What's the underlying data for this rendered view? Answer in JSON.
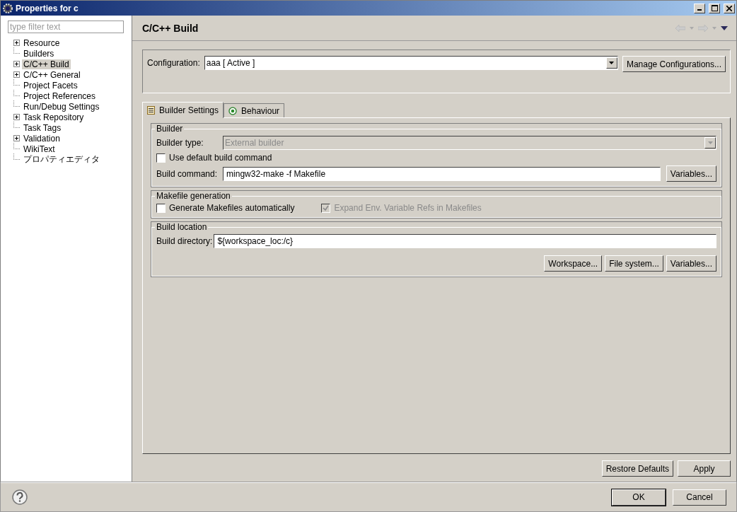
{
  "window": {
    "title": "Properties for c"
  },
  "sidebar": {
    "filter": {
      "placeholder": "type filter text"
    },
    "items": [
      {
        "label": "Resource",
        "kind": "expandable",
        "selected": false
      },
      {
        "label": "Builders",
        "kind": "leaf",
        "selected": false
      },
      {
        "label": "C/C++ Build",
        "kind": "expandable",
        "selected": true
      },
      {
        "label": "C/C++ General",
        "kind": "expandable",
        "selected": false
      },
      {
        "label": "Project Facets",
        "kind": "leaf",
        "selected": false
      },
      {
        "label": "Project References",
        "kind": "leaf",
        "selected": false
      },
      {
        "label": "Run/Debug Settings",
        "kind": "leaf",
        "selected": false
      },
      {
        "label": "Task Repository",
        "kind": "expandable",
        "selected": false
      },
      {
        "label": "Task Tags",
        "kind": "leaf",
        "selected": false
      },
      {
        "label": "Validation",
        "kind": "expandable",
        "selected": false
      },
      {
        "label": "WikiText",
        "kind": "leaf",
        "selected": false
      },
      {
        "label": "プロパティエディタ",
        "kind": "leaf",
        "selected": false
      }
    ]
  },
  "page": {
    "title": "C/C++ Build",
    "configuration": {
      "label": "Configuration:",
      "value": "aaa  [ Active ]",
      "button": "Manage Configurations..."
    },
    "tabs": [
      {
        "label": "Builder Settings",
        "selected": true
      },
      {
        "label": "Behaviour",
        "selected": false
      }
    ],
    "builder": {
      "legend": "Builder",
      "type_label": "Builder type:",
      "type_value": "External builder",
      "type_disabled": true,
      "default_command": {
        "label": "Use default build command",
        "checked": false,
        "disabled": false
      },
      "command_label": "Build command:",
      "command_value": "mingw32-make -f Makefile",
      "variables_button": "Variables..."
    },
    "makefile": {
      "legend": "Makefile generation",
      "checkboxes": [
        {
          "label": "Generate Makefiles automatically",
          "checked": false,
          "disabled": false
        },
        {
          "label": "Expand Env. Variable Refs in Makefiles",
          "checked": true,
          "disabled": true
        }
      ]
    },
    "location": {
      "legend": "Build location",
      "directory_label": "Build directory:",
      "directory_value": "${workspace_loc:/c}",
      "buttons": [
        "Workspace...",
        "File system...",
        "Variables..."
      ]
    },
    "page_buttons": [
      "Restore Defaults",
      "Apply"
    ]
  },
  "dialog_buttons": [
    "OK",
    "Cancel"
  ]
}
